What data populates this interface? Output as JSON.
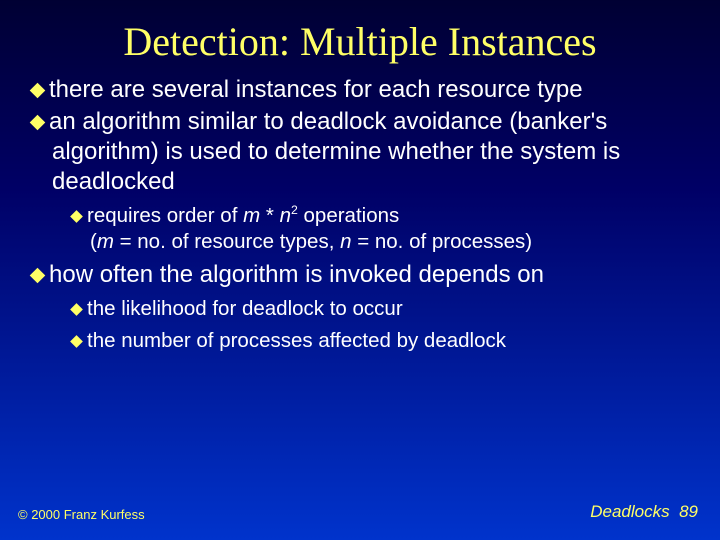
{
  "title": "Detection: Multiple Instances",
  "bullets": {
    "b1": "there are several instances for each resource type",
    "b2": "an algorithm similar to deadlock avoidance (banker's algorithm) is used to determine whether the system is deadlocked",
    "b2_1_pre": "requires order  of ",
    "b2_1_m": "m ",
    "b2_1_star": "* ",
    "b2_1_n": "n",
    "b2_1_exp": "2",
    "b2_1_post": "  operations",
    "b2_1_line2_open": "(",
    "b2_1_line2_m": "m",
    "b2_1_line2_mid1": " = no. of resource types, ",
    "b2_1_line2_n": "n",
    "b2_1_line2_mid2": " = no. of processes)",
    "b3": "how often the algorithm is invoked depends on",
    "b3_1": "the likelihood for deadlock to occur",
    "b3_2": "the number of processes affected by deadlock"
  },
  "footer": {
    "left": "© 2000 Franz Kurfess",
    "right_label": "Deadlocks",
    "right_num": "89"
  }
}
